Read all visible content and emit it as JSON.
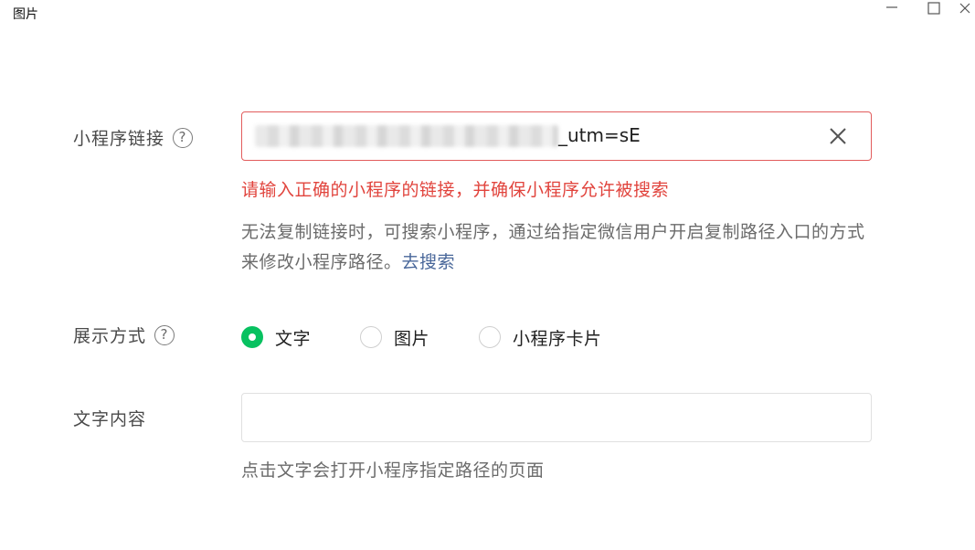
{
  "window": {
    "title": "图片"
  },
  "form": {
    "link": {
      "label": "小程序链接",
      "help_glyph": "?",
      "value": "_utm=sE",
      "error": "请输入正确的小程序的链接，并确保小程序允许被搜索",
      "hint": "无法复制链接时，可搜索小程序，通过给指定微信用户开启复制路径入口的方式来修改小程序路径。",
      "hint_link": "去搜索"
    },
    "display_mode": {
      "label": "展示方式",
      "help_glyph": "?",
      "options": [
        {
          "label": "文字",
          "checked": true
        },
        {
          "label": "图片",
          "checked": false
        },
        {
          "label": "小程序卡片",
          "checked": false
        }
      ]
    },
    "text_content": {
      "label": "文字内容",
      "value": "",
      "help": "点击文字会打开小程序指定路径的页面"
    }
  },
  "colors": {
    "error": "#e1443d",
    "accent_green": "#07c160",
    "link_blue": "#49679a"
  },
  "icons": {
    "minimize": "minimize-icon",
    "maximize": "maximize-icon",
    "close": "close-icon",
    "help": "question-circle-icon",
    "clear": "clear-x-icon"
  }
}
